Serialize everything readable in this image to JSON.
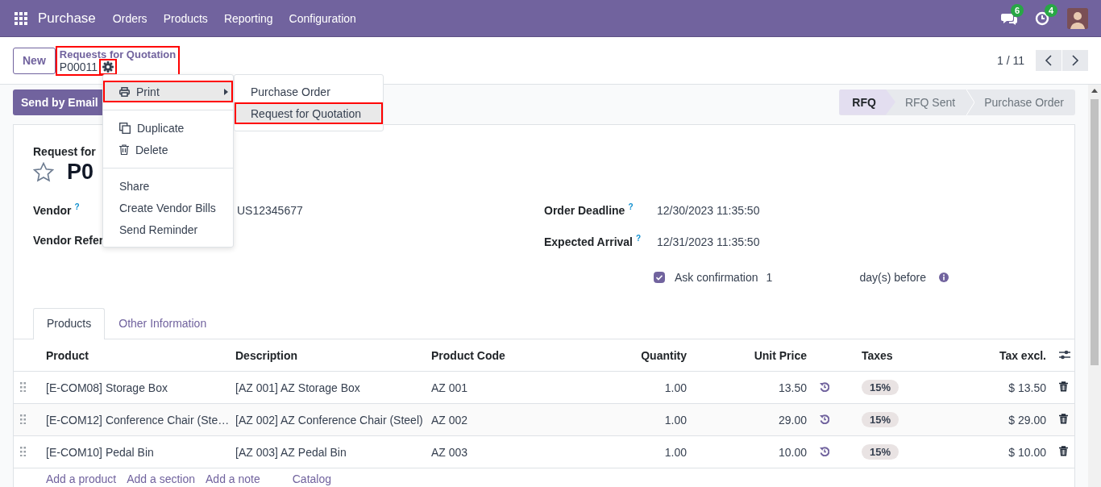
{
  "navbar": {
    "app": "Purchase",
    "menus": [
      "Orders",
      "Products",
      "Reporting",
      "Configuration"
    ],
    "messages_count": "6",
    "activities_count": "4"
  },
  "control_panel": {
    "new_button": "New",
    "breadcrumb": "Requests for Quotation",
    "record": "P00011",
    "breadcrumb_highlighted": true,
    "gear_highlighted": true,
    "pager": "1 / 11"
  },
  "action_menu": {
    "groups": [
      {
        "items": [
          {
            "kind": "printer",
            "label": "Print",
            "hovered": true,
            "highlighted": true
          }
        ]
      },
      {
        "items": [
          {
            "kind": "copies",
            "label": "Duplicate",
            "hovered": false,
            "highlighted": false
          },
          {
            "kind": "trash",
            "label": "Delete",
            "hovered": false,
            "highlighted": false
          }
        ]
      },
      {
        "items": [
          {
            "kind": "plain",
            "label": "Share",
            "hovered": false,
            "highlighted": false
          },
          {
            "kind": "plain",
            "label": "Create Vendor Bills",
            "hovered": false,
            "highlighted": false
          },
          {
            "kind": "plain",
            "label": "Send Reminder",
            "hovered": false,
            "highlighted": false
          }
        ]
      }
    ],
    "submenu": [
      {
        "label": "Purchase Order",
        "hovered": false,
        "highlighted": false
      },
      {
        "label": "Request for Quotation",
        "hovered": true,
        "highlighted": true
      }
    ]
  },
  "form_header": {
    "send_button": "Send by Email",
    "stages": [
      {
        "label": "RFQ",
        "selected": true
      },
      {
        "label": "RFQ Sent",
        "selected": false
      },
      {
        "label": "Purchase Order",
        "selected": false
      }
    ]
  },
  "sheet": {
    "title_label": "Request for",
    "name": "P0",
    "starred": false,
    "left_fields": [
      {
        "label": "Vendor",
        "help": "?",
        "value": "US12345677"
      },
      {
        "label": "Vendor Refer"
      }
    ],
    "right_fields": [
      {
        "label": "Order Deadline",
        "help": "?",
        "value": "12/30/2023 11:35:50"
      },
      {
        "label": "Expected Arrival",
        "help": "?",
        "value": "12/31/2023 11:35:50"
      }
    ],
    "ask_confirmation": {
      "label": "Ask confirmation",
      "checked": true,
      "days": "1",
      "suffix": "day(s) before"
    },
    "tabs": [
      {
        "label": "Products",
        "selected": true
      },
      {
        "label": "Other Information",
        "selected": false
      }
    ],
    "table": {
      "columns": [
        "Product",
        "Description",
        "Product Code",
        "Quantity",
        "Unit Price",
        "Taxes",
        "Tax excl."
      ],
      "rows": [
        {
          "product": "[E-COM08] Storage Box",
          "description": "[AZ 001] AZ Storage Box",
          "code": "AZ 001",
          "quantity": "1.00",
          "unit_price": "13.50",
          "tax": "15%",
          "total": "$ 13.50"
        },
        {
          "product": "[E-COM12] Conference Chair (Ste…",
          "description": "[AZ 002] AZ Conference Chair (Steel)",
          "code": "AZ 002",
          "quantity": "1.00",
          "unit_price": "29.00",
          "tax": "15%",
          "total": "$ 29.00"
        },
        {
          "product": "[E-COM10] Pedal Bin",
          "description": "[AZ 003] AZ Pedal Bin",
          "code": "AZ 003",
          "quantity": "1.00",
          "unit_price": "10.00",
          "tax": "15%",
          "total": "$ 10.00"
        }
      ],
      "add_links": [
        "Add a product",
        "Add a section",
        "Add a note",
        "Catalog"
      ]
    }
  }
}
